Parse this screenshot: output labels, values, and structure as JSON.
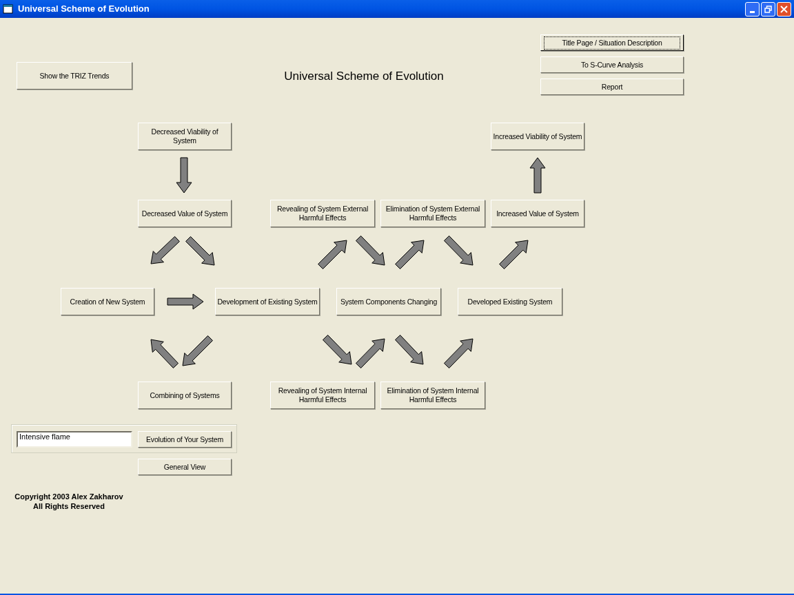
{
  "window": {
    "title": "Universal Scheme of Evolution"
  },
  "trends_button": "Show the TRIZ Trends",
  "heading": "Universal Scheme of Evolution",
  "nav_buttons": [
    {
      "label": "Title Page / Situation Description",
      "focused": true
    },
    {
      "label": "To S-Curve Analysis",
      "focused": false
    },
    {
      "label": "Report",
      "focused": false
    }
  ],
  "nodes": [
    "Decreased Viability of System",
    "Increased Viability of System",
    "Decreased Value of System",
    "Revealing of System External Harmful Effects",
    "Elimination of System External Harmful Effects",
    "Increased Value of System",
    "Creation of New System",
    "Development of Existing System",
    "System Components Changing",
    "Developed Existing System",
    "Combining of Systems",
    "Revealing of System Internal Harmful Effects",
    "Elimination of System Internal Harmful Effects"
  ],
  "system_field": {
    "value": "Intensive flame"
  },
  "evolution_button": "Evolution of Your System",
  "general_view_button": "General View",
  "copyright": [
    "Copyright 2003 Alex Zakharov",
    "All Rights Reserved"
  ]
}
